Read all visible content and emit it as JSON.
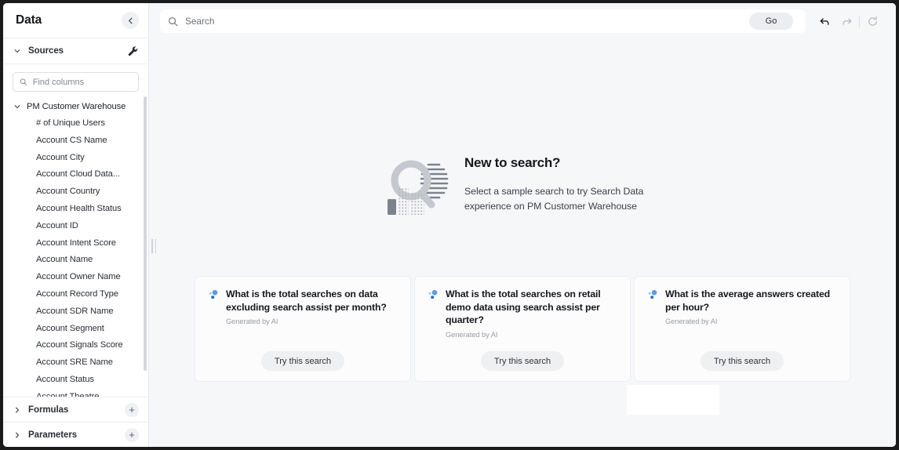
{
  "sidebar": {
    "title": "Data",
    "collapse_icon": "chevron-left-icon",
    "sources": {
      "label": "Sources",
      "expand_icon": "chevron-down-icon",
      "settings_icon": "wrench-icon"
    },
    "find": {
      "placeholder": "Find columns",
      "value": "",
      "icon": "search-icon"
    },
    "datasource": {
      "name": "PM Customer Warehouse",
      "expand_icon": "chevron-down-icon"
    },
    "columns": [
      "# of Unique Users",
      "Account CS Name",
      "Account City",
      "Account Cloud Data...",
      "Account Country",
      "Account Health Status",
      "Account ID",
      "Account Intent Score",
      "Account Name",
      "Account Owner Name",
      "Account Record Type",
      "Account SDR Name",
      "Account Segment",
      "Account Signals Score",
      "Account SRE Name",
      "Account Status",
      "Account Theatre"
    ],
    "footer": [
      {
        "label": "Formulas",
        "expand_icon": "chevron-right-icon",
        "add_icon": "plus-icon",
        "add_label": "+"
      },
      {
        "label": "Parameters",
        "expand_icon": "chevron-right-icon",
        "add_icon": "plus-icon",
        "add_label": "+"
      }
    ]
  },
  "topbar": {
    "search": {
      "placeholder": "Search",
      "value": "",
      "icon": "search-icon"
    },
    "go_label": "Go",
    "undo_icon": "undo-arrow-icon",
    "redo_icon": "redo-arrow-icon",
    "reset_icon": "refresh-icon"
  },
  "hero": {
    "illustration": "magnifying-glass-illustration",
    "title": "New to search?",
    "subtitle": "Select a sample search to try Search Data experience on PM Customer Warehouse"
  },
  "cards": [
    {
      "icon": "ai-sparkle-icon",
      "question": "What is the total searches on data excluding search assist per month?",
      "meta": "Generated by AI",
      "button": "Try this search"
    },
    {
      "icon": "ai-sparkle-icon",
      "question": "What is the total searches on retail demo data using search assist per quarter?",
      "meta": "Generated by AI",
      "button": "Try this search"
    },
    {
      "icon": "ai-sparkle-icon",
      "question": "What is the average answers created per hour?",
      "meta": "Generated by AI",
      "button": "Try this search"
    }
  ],
  "colors": {
    "accent_blue": "#4a90e2",
    "page_bg": "#f6f7f9",
    "panel_bg": "#ffffff",
    "card_bg": "#fcfcfd",
    "text_primary": "#15181c",
    "text_muted": "#989ca3"
  }
}
